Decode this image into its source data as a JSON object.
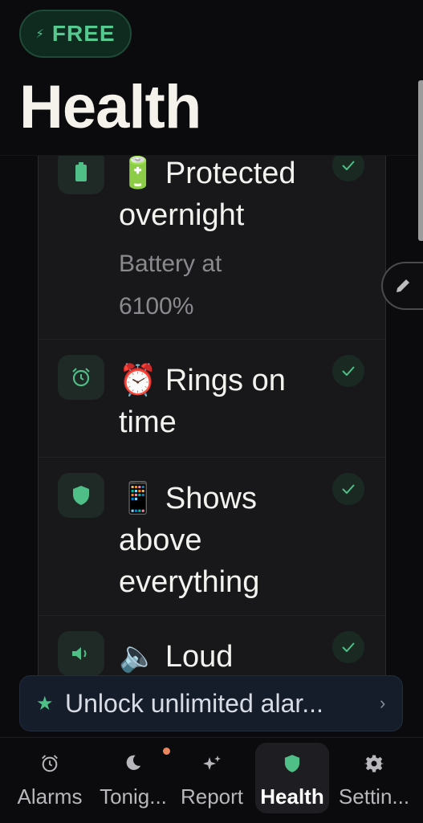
{
  "header": {
    "badge_bolt": "⚡",
    "badge_label": "FREE",
    "title": "Health"
  },
  "checks": [
    {
      "emoji": "🔋",
      "title": "Protected overnight",
      "subtitle_line1": "Battery at",
      "subtitle_line2": "6100%",
      "icon": "battery-icon",
      "status": "passed"
    },
    {
      "emoji": "⏰",
      "title": "Rings on time",
      "icon": "alarm-clock-icon",
      "status": "passed"
    },
    {
      "emoji": "📱",
      "title": "Shows above everything",
      "icon": "shield-icon",
      "status": "passed"
    },
    {
      "emoji": "🔈",
      "title": "Loud",
      "icon": "speaker-icon",
      "status": "passed"
    }
  ],
  "upsell": {
    "star": "★",
    "label": "Unlock unlimited alar...",
    "chevron": "›"
  },
  "nav": {
    "items": [
      {
        "label": "Alarms",
        "icon": "alarm-clock-icon"
      },
      {
        "label": "Tonig...",
        "icon": "moon-icon",
        "badge": true
      },
      {
        "label": "Report",
        "icon": "sparkle-icon"
      },
      {
        "label": "Health",
        "icon": "shield-icon",
        "active": true
      },
      {
        "label": "Settin...",
        "icon": "gear-icon"
      }
    ]
  },
  "colors": {
    "accent": "#4fbf87",
    "background": "#0b0b0d",
    "card": "#18181b",
    "notification_dot": "#e8885c"
  }
}
